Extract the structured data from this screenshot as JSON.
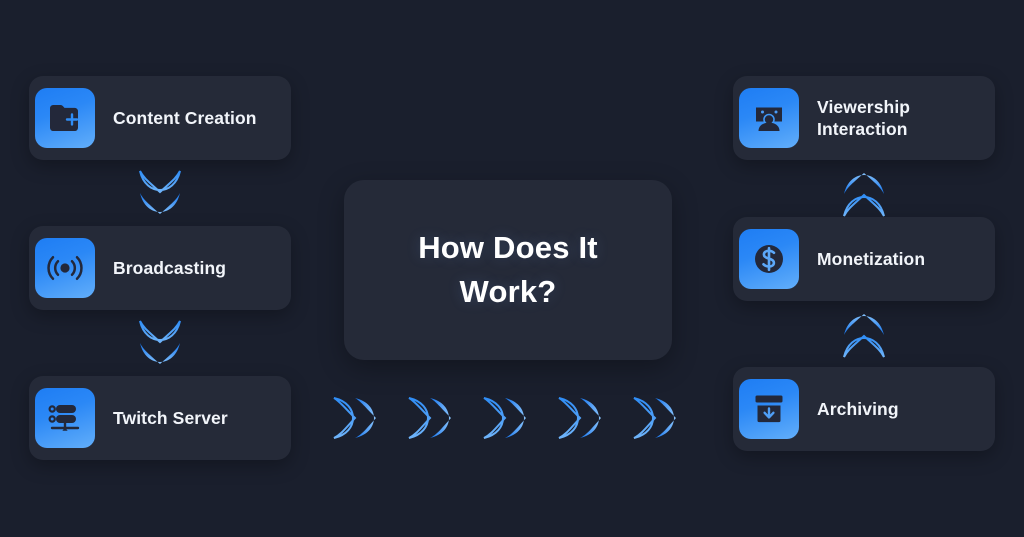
{
  "background_color": "#1a1f2d",
  "card_color": "#252a38",
  "accent_gradient": [
    "#1e7df4",
    "#62aefa"
  ],
  "text_color": "#f2f5fa",
  "center": {
    "title": "How Does It Work?"
  },
  "left_column": {
    "steps": [
      {
        "label": "Content Creation",
        "icon": "folder-plus-icon"
      },
      {
        "label": "Broadcasting",
        "icon": "broadcast-signal-icon"
      },
      {
        "label": "Twitch Server",
        "icon": "server-rack-icon"
      }
    ]
  },
  "right_column": {
    "steps": [
      {
        "label": "Viewership\nInteraction",
        "icon": "viewer-screen-icon"
      },
      {
        "label": "Monetization",
        "icon": "dollar-coin-icon"
      },
      {
        "label": "Archiving",
        "icon": "archive-box-down-icon"
      }
    ]
  },
  "connectors": {
    "left_down": [
      {
        "direction": "down",
        "icon": "double-chevron-down-icon"
      },
      {
        "direction": "down",
        "icon": "double-chevron-down-icon"
      }
    ],
    "right_up": [
      {
        "direction": "up",
        "icon": "double-chevron-up-icon"
      },
      {
        "direction": "up",
        "icon": "double-chevron-up-icon"
      }
    ],
    "center_right": [
      {
        "direction": "right",
        "icon": "double-chevron-right-icon"
      },
      {
        "direction": "right",
        "icon": "double-chevron-right-icon"
      },
      {
        "direction": "right",
        "icon": "double-chevron-right-icon"
      },
      {
        "direction": "right",
        "icon": "double-chevron-right-icon"
      },
      {
        "direction": "right",
        "icon": "double-chevron-right-icon"
      }
    ]
  }
}
